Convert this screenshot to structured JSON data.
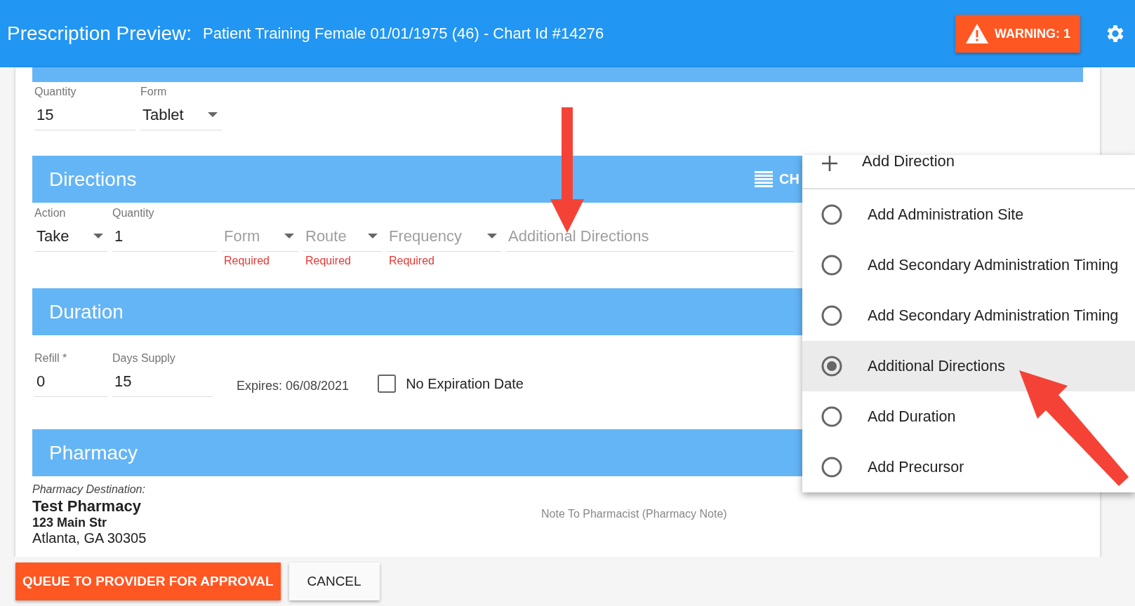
{
  "header": {
    "title": "Prescription Preview:",
    "subtitle": "Patient Training Female 01/01/1975 (46) - Chart Id #14276",
    "warning": "WARNING: 1"
  },
  "dispense": {
    "fields": [
      {
        "label": "Quantity",
        "value": "15",
        "kind": "text"
      },
      {
        "label": "Form",
        "value": "Tablet",
        "kind": "select"
      }
    ]
  },
  "directions": {
    "title": "Directions",
    "action": "CH",
    "fields": [
      {
        "label": "Action",
        "value": "Take",
        "kind": "select"
      },
      {
        "label": "Quantity",
        "value": "1",
        "kind": "text"
      },
      {
        "placeholder": "Form",
        "kind": "select",
        "error": "Required"
      },
      {
        "placeholder": "Route",
        "kind": "select",
        "error": "Required"
      },
      {
        "placeholder": "Frequency",
        "kind": "select",
        "error": "Required"
      },
      {
        "placeholder": "Additional Directions",
        "kind": "text"
      }
    ]
  },
  "duration": {
    "title": "Duration",
    "fields": [
      {
        "label": "Refill *",
        "value": "0",
        "kind": "text"
      },
      {
        "label": "Days Supply",
        "value": "15",
        "kind": "text"
      }
    ],
    "expires": "Expires: 06/08/2021",
    "no_expiration": {
      "label": "No Expiration Date",
      "checked": false
    }
  },
  "pharmacy": {
    "title": "Pharmacy",
    "destination_label": "Pharmacy Destination:",
    "name": "Test Pharmacy",
    "address": "123 Main Str",
    "city": "Atlanta, GA 30305",
    "note_label": "Note To Pharmacist (Pharmacy Note)"
  },
  "menu": {
    "header": "Add Direction",
    "items": [
      {
        "label": "Add Administration Site",
        "selected": false
      },
      {
        "label": "Add Secondary Administration Timing",
        "selected": false
      },
      {
        "label": "Add Secondary Administration Timing",
        "selected": false
      },
      {
        "label": "Additional Directions",
        "selected": true
      },
      {
        "label": "Add Duration",
        "selected": false
      },
      {
        "label": "Add Precursor",
        "selected": false
      }
    ]
  },
  "footer": {
    "buttons": [
      {
        "label": "QUEUE TO PROVIDER FOR APPROVAL",
        "kind": "primary"
      },
      {
        "label": "CANCEL",
        "kind": "secondary"
      }
    ]
  }
}
